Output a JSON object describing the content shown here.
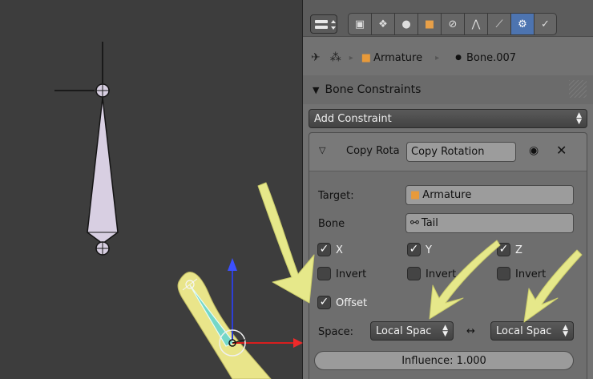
{
  "panel": {
    "breadcrumb": {
      "object": "Armature",
      "bone": "Bone.007"
    },
    "section_title": "Bone Constraints",
    "add_constraint_label": "Add Constraint",
    "constraint": {
      "short_name": "Copy Rota",
      "name_value": "Copy Rotation",
      "target_label": "Target:",
      "target_value": "Armature",
      "bone_label": "Bone",
      "bone_value": "Tail",
      "axes": [
        {
          "label": "X",
          "checked": true
        },
        {
          "label": "Y",
          "checked": true
        },
        {
          "label": "Z",
          "checked": true
        }
      ],
      "invert_label": "Invert",
      "offset_label": "Offset",
      "space_label": "Space:",
      "space_owner": "Local Spac",
      "space_arrow": "↔",
      "space_target": "Local Spac",
      "influence_label": "Influence: 1.000"
    }
  },
  "colors": {
    "viewport_bg": "#3d3d3d",
    "panel_bg": "#727272",
    "bone_fill": "#d6cde0",
    "annotation_yellow": "#e9eb8c",
    "active_tab": "#4d74b0"
  }
}
